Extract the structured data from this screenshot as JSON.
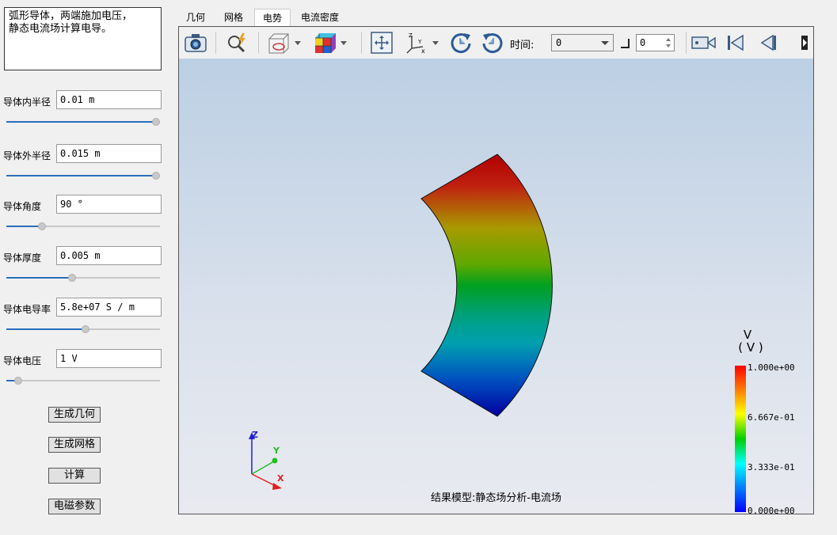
{
  "description": "弧形导体，两端施加电压，\n静态电流场计算电导。",
  "params": [
    {
      "label": "导体内半径",
      "value": "0.01 m",
      "slider": 1.0
    },
    {
      "label": "导体外半径",
      "value": "0.015 m",
      "slider": 1.0
    },
    {
      "label": "导体角度",
      "value": "90 °",
      "slider": 0.24
    },
    {
      "label": "导体厚度",
      "value": "0.005 m",
      "slider": 0.44
    },
    {
      "label": "导体电导率",
      "value": "5.8e+07 S / m",
      "slider": 0.53
    },
    {
      "label": "导体电压",
      "value": "1 V",
      "slider": 0.08
    }
  ],
  "buttons": {
    "gen_geometry": "生成几何",
    "gen_mesh": "生成网格",
    "compute": "计算",
    "em_params": "电磁参数"
  },
  "tabs": [
    "几何",
    "网格",
    "电势",
    "电流密度"
  ],
  "active_tab": 2,
  "toolbar": {
    "time_label": "时间:",
    "time_value": "0",
    "step_value": "0",
    "icons": [
      "camera-icon",
      "zoom-flash-icon",
      "box-display-icon",
      "color-cube-icon",
      "fit-view-icon",
      "axes-orient-icon",
      "rotate-cw-icon",
      "rotate-ccw-icon",
      "record-icon",
      "first-frame-icon",
      "prev-frame-icon",
      "next-frame-icon"
    ]
  },
  "colorbar": {
    "title": "V",
    "unit": "( V )",
    "ticks": [
      "1.000e+00",
      "6.667e-01",
      "3.333e-01",
      "0.000e+00"
    ],
    "min": 0,
    "max": 1
  },
  "axes": {
    "x": "X",
    "y": "Y",
    "z": "Z"
  },
  "caption": "结果模型:静态场分析-电流场",
  "colors": {
    "accent": "#2a6ebb",
    "x_axis": "#e02020",
    "y_axis": "#20c020",
    "z_axis": "#2020d0"
  }
}
